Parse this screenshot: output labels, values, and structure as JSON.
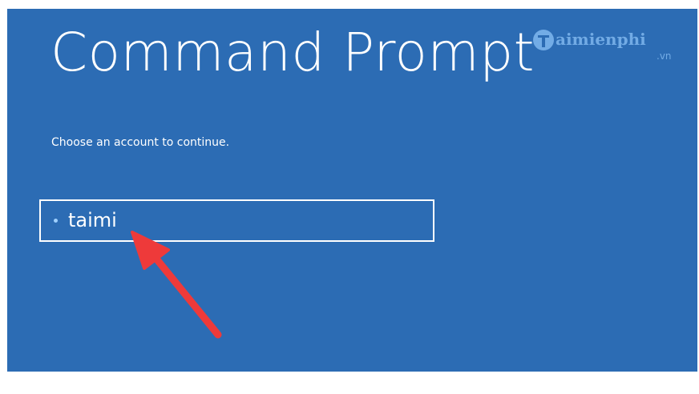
{
  "screen": {
    "title": "Command Prompt",
    "subtitle": "Choose an account to continue."
  },
  "accounts": [
    {
      "name": "taimi"
    }
  ],
  "watermark": {
    "text": "aimienphi",
    "suffix": ".vn"
  },
  "colors": {
    "background": "#2c6cb4",
    "text": "#ffffff",
    "arrow": "#ee3a3a",
    "bullet": "#9fd0ff"
  }
}
